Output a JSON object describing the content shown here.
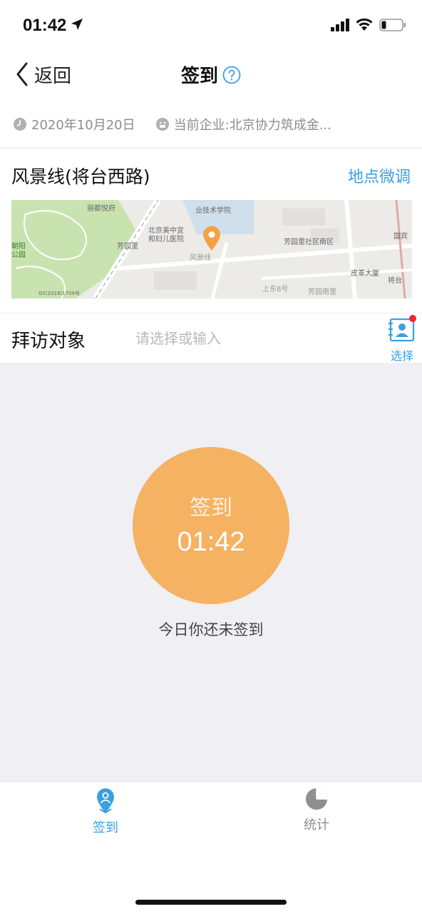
{
  "status_bar": {
    "time": "01:42",
    "location_icon": "location-arrow-icon",
    "signal_icon": "cellular-signal-icon",
    "wifi_icon": "wifi-icon",
    "battery_icon": "battery-low-icon"
  },
  "navbar": {
    "back_label": "返回",
    "title": "签到",
    "help_icon": "question-circle-icon"
  },
  "info": {
    "date": "2020年10月20日",
    "company": "当前企业:北京协力筑成金..."
  },
  "location": {
    "name": "风景线(将台西路)",
    "adjust_label": "地点微调"
  },
  "map": {
    "labels": [
      "丽都悦府",
      "业技术学院",
      "北京美中宜",
      "和妇儿医院",
      "芳园里",
      "风景线",
      "芳园里社区南区",
      "国宾",
      "皮革大厦",
      "将台",
      "朝阳",
      "公园",
      "上东8号",
      "芳园南里",
      "GS(2018)1709号"
    ],
    "marker_icon": "map-pin-icon",
    "marker_color": "#f5a243"
  },
  "visit": {
    "label": "拜访对象",
    "placeholder": "请选择或输入",
    "select_label": "选择",
    "select_icon": "contact-book-icon",
    "badge_color": "#f5222d"
  },
  "checkin": {
    "button_label": "签到",
    "time": "01:42",
    "status": "今日你还未签到",
    "circle_color": "#f5b263"
  },
  "tabs": {
    "checkin": {
      "label": "签到",
      "icon": "person-pin-icon"
    },
    "stats": {
      "label": "统计",
      "icon": "pie-chart-icon"
    }
  },
  "colors": {
    "accent": "#3aa0e0",
    "background": "#efeff4"
  }
}
